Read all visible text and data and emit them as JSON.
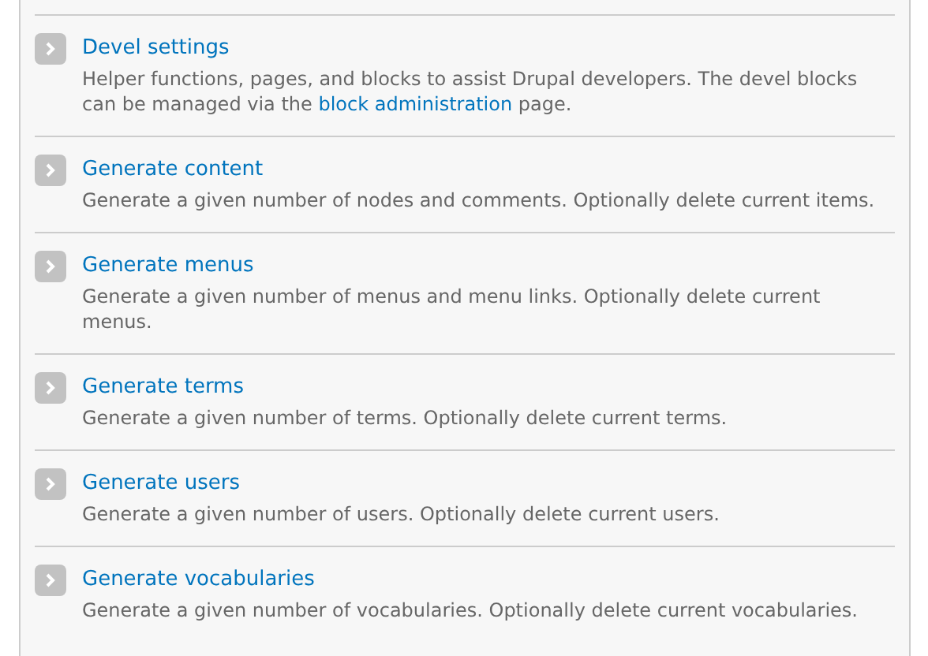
{
  "items": [
    {
      "title": "Devel settings",
      "description": [
        {
          "kind": "text",
          "text": "Helper functions, pages, and blocks to assist Drupal developers. The devel blocks can be managed via the "
        },
        {
          "kind": "link",
          "text": "block administration"
        },
        {
          "kind": "text",
          "text": " page."
        }
      ]
    },
    {
      "title": "Generate content",
      "description": [
        {
          "kind": "text",
          "text": "Generate a given number of nodes and comments. Optionally delete current items."
        }
      ]
    },
    {
      "title": "Generate menus",
      "description": [
        {
          "kind": "text",
          "text": "Generate a given number of menus and menu links. Optionally delete current menus."
        }
      ]
    },
    {
      "title": "Generate terms",
      "description": [
        {
          "kind": "text",
          "text": "Generate a given number of terms. Optionally delete current terms."
        }
      ]
    },
    {
      "title": "Generate users",
      "description": [
        {
          "kind": "text",
          "text": "Generate a given number of users. Optionally delete current users."
        }
      ]
    },
    {
      "title": "Generate vocabularies",
      "description": [
        {
          "kind": "text",
          "text": "Generate a given number of vocabularies. Optionally delete current vocabularies."
        }
      ]
    }
  ]
}
